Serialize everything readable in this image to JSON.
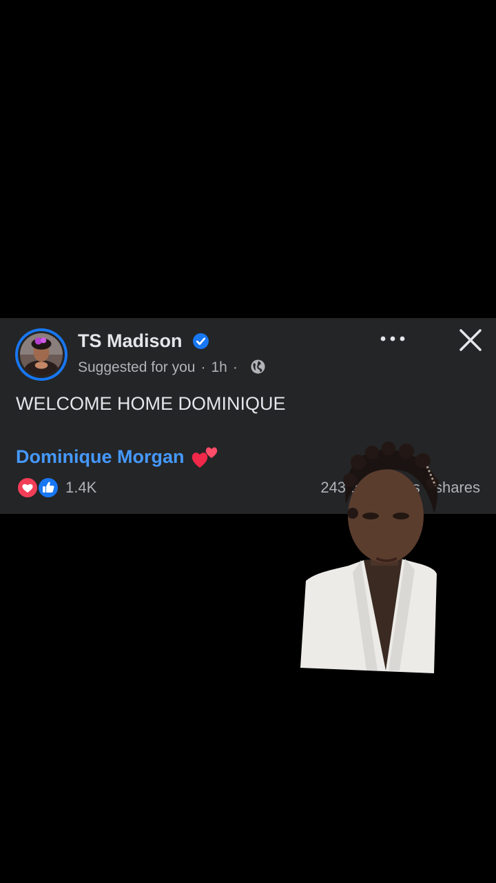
{
  "post": {
    "author": "TS Madison",
    "suggested": "Suggested for you",
    "time": "1h",
    "separator": "·",
    "body": "WELCOME HOME DOMINIQUE",
    "tagged_name": "Dominique Morgan",
    "reaction_count": "1.4K",
    "comments": "243 comments",
    "shares": "shares"
  },
  "icons": {
    "verified": "verified-badge-icon",
    "audience": "globe-icon",
    "menu": "more-options-icon",
    "close": "close-icon",
    "emoji": "two-hearts-icon",
    "reactions": [
      "love-reaction-icon",
      "like-reaction-icon"
    ]
  },
  "colors": {
    "background": "#000000",
    "card": "#242526",
    "primary_text": "#e4e6eb",
    "secondary_text": "#b0b3b8",
    "link": "#4599ff",
    "brand_blue": "#1877f2",
    "love_red": "#f33e58"
  }
}
